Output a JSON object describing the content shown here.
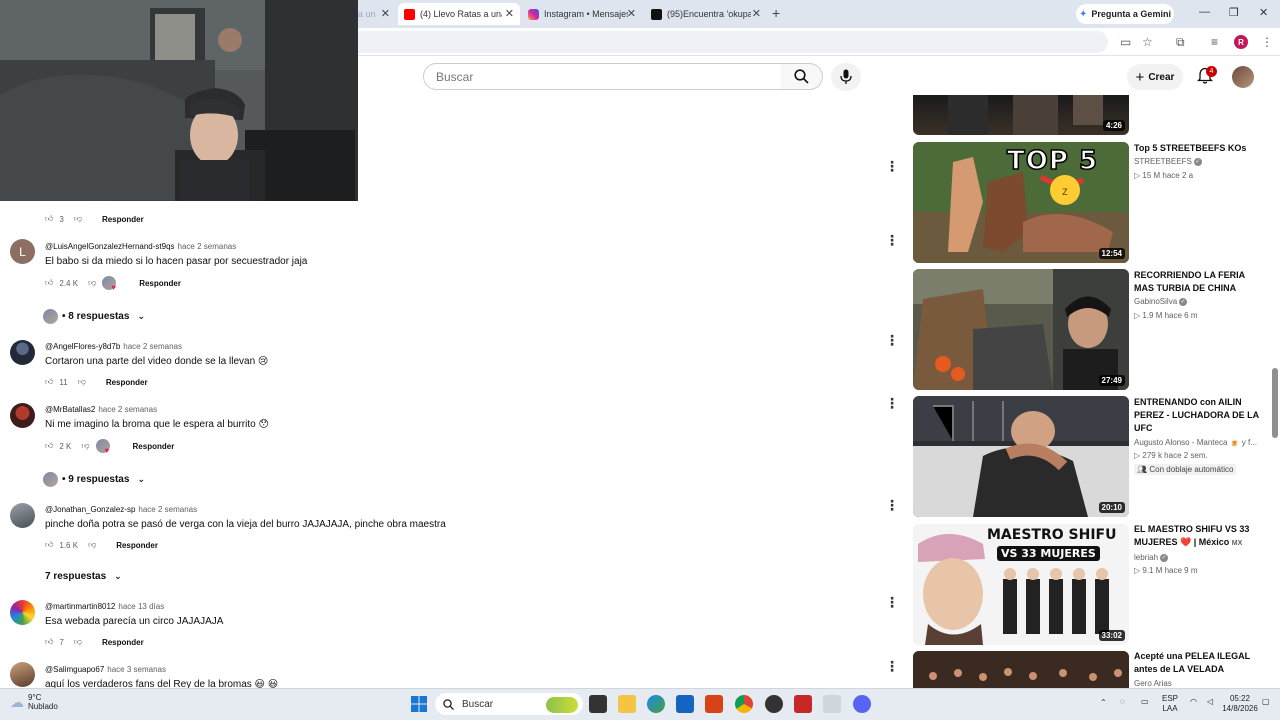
{
  "browser": {
    "tabs": [
      {
        "title": "a un",
        "active": false
      },
      {
        "title": "(4) Llevo Ratas a una",
        "active": true
      },
      {
        "title": "Instagram • Mensajes",
        "active": false
      },
      {
        "title": "(95)Encuentra 'okupa",
        "active": false
      }
    ],
    "gemini_label": "Pregunta a Gemini",
    "profile_initial": "R"
  },
  "youtube": {
    "search_placeholder": "Buscar",
    "create_label": "Crear",
    "notifications_count": "4"
  },
  "comments": [
    {
      "likes": "3",
      "reply_label": "Responder"
    },
    {
      "avatar_letter": "L",
      "user": "@LuisAngelGonzalezHernand-st9qs",
      "time": "hace 2 semanas",
      "text": "El babo si da miedo si lo hacen pasar por secuestrador jaja",
      "likes": "2.4 K",
      "reply_label": "Responder",
      "replies": "• 8 respuestas"
    },
    {
      "user": "@AngelFlores-y8d7b",
      "time": "hace 2 semanas",
      "text": "Cortaron una parte del video donde se la llevan 😢",
      "likes": "11",
      "reply_label": "Responder"
    },
    {
      "user": "@MrBatallas2",
      "time": "hace 2 semanas",
      "text": "Ni me imagino la broma que le espera al burrito 😯",
      "likes": "2 K",
      "reply_label": "Responder",
      "replies": "• 9 respuestas"
    },
    {
      "user": "@Jonathan_Gonzalez-sp",
      "time": "hace 2 semanas",
      "text": "pinche doña potra se pasó de verga con la vieja del burro JAJAJAJA, pinche obra maestra",
      "likes": "1.6 K",
      "reply_label": "Responder",
      "replies": "7 respuestas"
    },
    {
      "user": "@martinmartin8012",
      "time": "hace 13 días",
      "text": "Esa webada parecía un circo JAJAJAJA",
      "likes": "7",
      "reply_label": "Responder"
    },
    {
      "user": "@Salimguapo67",
      "time": "hace 3 semanas",
      "text": "aquí los verdaderos fans del Rey de la bromas 😃 😃"
    }
  ],
  "sidebar": [
    {
      "duration": "4:26"
    },
    {
      "title": "Top 5 STREETBEEFS KOs",
      "channel": "STREETBEEFS",
      "meta": "15 M   hace 2 a",
      "duration": "12:54",
      "thumb_text": "TOP 5"
    },
    {
      "title": "RECORRIENDO LA FERIA MAS TURBIA DE CHINA",
      "channel": "GabinoSilva",
      "meta": "1.9 M   hace 6 m",
      "duration": "27:49"
    },
    {
      "title": "ENTRENANDO con AILIN PEREZ - LUCHADORA DE LA UFC",
      "channel": "Augusto Alonso - Manteca 🍺 y f...",
      "meta": "279 k   hace 2 sem.",
      "badge": "Con doblaje automático",
      "duration": "20:10"
    },
    {
      "title": "EL MAESTRO SHIFU VS 33 MUJERES ❤️ | México",
      "title_suffix": "MX",
      "channel": "lebriah",
      "meta": "9.1 M   hace 9 m",
      "duration": "33:02",
      "thumb_text": "MAESTRO SHIFU",
      "thumb_text2": "VS 33 MUJERES"
    },
    {
      "title": "Acepté una PELEA ILEGAL antes de LA VELADA",
      "channel": "Gero Arias"
    }
  ],
  "taskbar": {
    "temperature": "9°C",
    "weather": "Nublado",
    "search_label": "Buscar",
    "lang": "ESP",
    "lang2": "LAA",
    "time": "05:22",
    "date": "14/8/2026"
  }
}
